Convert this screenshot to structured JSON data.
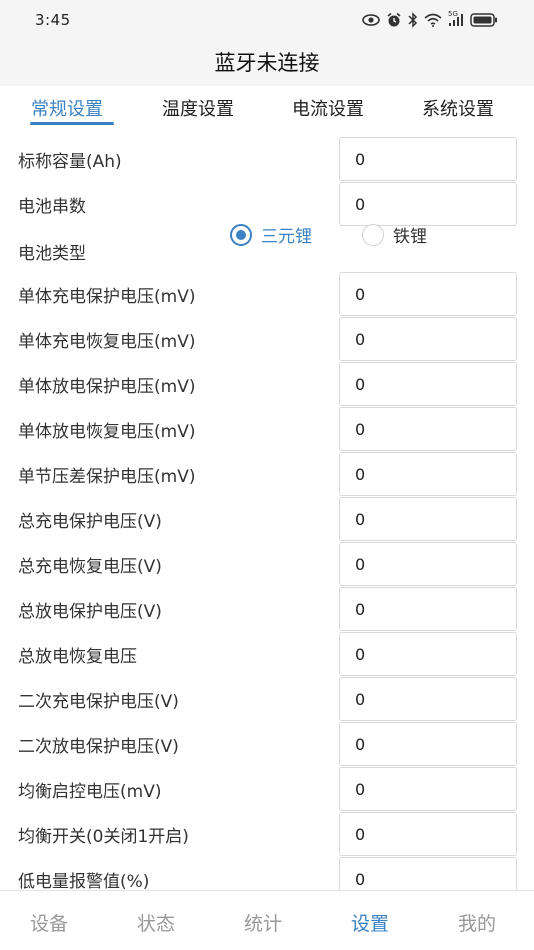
{
  "status_bar": {
    "time": "3:45",
    "icons": [
      "eye-icon",
      "alarm-icon",
      "bluetooth-icon",
      "wifi-icon",
      "signal-icon",
      "battery-icon"
    ],
    "network_label": "5G"
  },
  "header": {
    "title": "蓝牙未连接"
  },
  "tabs": [
    {
      "label": "常规设置",
      "active": true
    },
    {
      "label": "温度设置",
      "active": false
    },
    {
      "label": "电流设置",
      "active": false
    },
    {
      "label": "系统设置",
      "active": false
    }
  ],
  "form": {
    "rows": [
      {
        "label": "标称容量(Ah)",
        "value": "0"
      },
      {
        "label": "电池串数",
        "value": "0"
      },
      {
        "label": "电池类型",
        "radio": true,
        "options": [
          "三元锂",
          "铁锂"
        ],
        "selected": "三元锂"
      },
      {
        "label": "单体充电保护电压(mV)",
        "value": "0"
      },
      {
        "label": "单体充电恢复电压(mV)",
        "value": "0"
      },
      {
        "label": "单体放电保护电压(mV)",
        "value": "0"
      },
      {
        "label": "单体放电恢复电压(mV)",
        "value": "0"
      },
      {
        "label": "单节压差保护电压(mV)",
        "value": "0"
      },
      {
        "label": "总充电保护电压(V)",
        "value": "0"
      },
      {
        "label": "总充电恢复电压(V)",
        "value": "0"
      },
      {
        "label": "总放电保护电压(V)",
        "value": "0"
      },
      {
        "label": "总放电恢复电压",
        "value": "0"
      },
      {
        "label": "二次充电保护电压(V)",
        "value": "0"
      },
      {
        "label": "二次放电保护电压(V)",
        "value": "0"
      },
      {
        "label": "均衡启控电压(mV)",
        "value": "0"
      },
      {
        "label": "均衡开关(0关闭1开启)",
        "value": "0"
      },
      {
        "label": "低电量报警值(%)",
        "value": "0"
      }
    ]
  },
  "bottom_nav": [
    {
      "label": "设备",
      "active": false
    },
    {
      "label": "状态",
      "active": false
    },
    {
      "label": "统计",
      "active": false
    },
    {
      "label": "设置",
      "active": true
    },
    {
      "label": "我的",
      "active": false
    }
  ],
  "colors": {
    "accent": "#3b82c4",
    "text": "#333333",
    "muted": "#999999",
    "header_bg": "#f5f5f5"
  }
}
